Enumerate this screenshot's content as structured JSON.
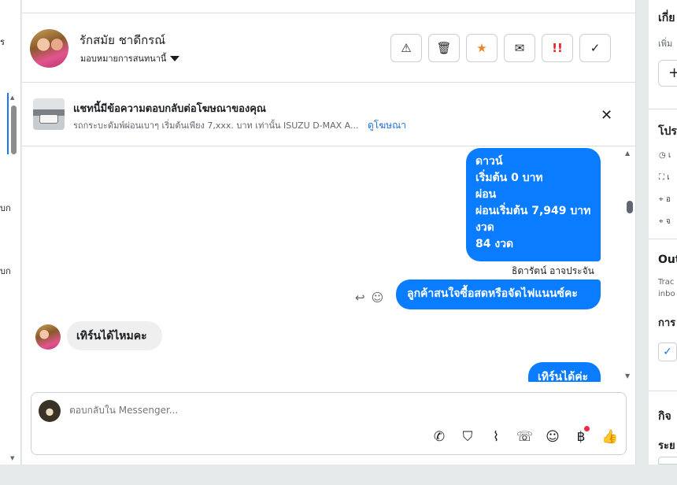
{
  "left_strip": {
    "fragments": [
      "ร",
      "บก",
      "บก"
    ]
  },
  "header": {
    "contact_name": "รักสมัย ชาดีกรณ์",
    "assign_label": "มอบหมายการสนทนานี้",
    "actions": [
      {
        "icon": "warning-icon",
        "glyph": "⚠"
      },
      {
        "icon": "trash-icon",
        "glyph": "🗑"
      },
      {
        "icon": "star-icon",
        "glyph": "★",
        "color": "#e8862a"
      },
      {
        "icon": "envelope-open-icon",
        "glyph": "✉"
      },
      {
        "icon": "priority-icon",
        "glyph": "!!",
        "color": "#e02424"
      },
      {
        "icon": "checkmark-icon",
        "glyph": "✓"
      }
    ]
  },
  "ad_banner": {
    "title": "แชทนี้มีข้อความตอบกลับต่อโฆษณาของคุณ",
    "subtitle": "รถกระบะดัมพ์ผ่อนเบาๆ เริ่มต้นเพียง 7,xxx. บาท เท่านั้น ISUZU D-MAX A...",
    "link": "ดูโฆษณา",
    "close": "✕"
  },
  "messages": [
    {
      "type": "outgoing",
      "lines": [
        "ดาวน์",
        "เริ่มต้น 0 บาท",
        "ผ่อน",
        "ผ่อนเริ่มต้น 7,949 บาท",
        "งวด",
        "84 งวด"
      ]
    },
    {
      "type": "sender",
      "text": "ธิดารัตน์ อาจประจัน"
    },
    {
      "type": "outgoing",
      "text": "ลูกค้าสนใจซื้อสดหรือจัดไฟแนนซ์คะ"
    },
    {
      "type": "incoming",
      "text": "เทิร์นได้ไหมคะ"
    },
    {
      "type": "outgoing",
      "text": "เทิร์นได้ค่ะ"
    }
  ],
  "composer": {
    "placeholder": "ตอบกลับใน Messenger...",
    "tools": [
      "phone-add-icon",
      "shopping-bag-icon",
      "paperclip-icon",
      "chat-bubble-icon",
      "emoji-icon",
      "baht-icon",
      "thumbs-up-icon"
    ]
  },
  "right_panel": {
    "section1_title": "เกี่ย",
    "section1_sub": "เพิ่ม",
    "section2_title": "โปร",
    "info_rows": [
      "เ",
      "เ",
      "อ",
      "จ"
    ],
    "section3_title": "Out",
    "section3_desc1": "Trac",
    "section3_desc2": "inbo",
    "section3_label": "การ",
    "section4_title": "กิจ",
    "section4_label": "ระย"
  }
}
